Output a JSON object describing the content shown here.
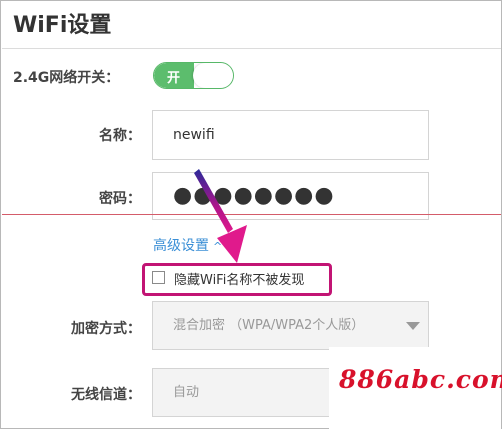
{
  "page": {
    "title": "WiFi设置"
  },
  "wifi_switch": {
    "label": "2.4G网络开关：",
    "state_text": "开",
    "on": true
  },
  "name_field": {
    "label": "名称：",
    "value": "newifi"
  },
  "password_field": {
    "label": "密码：",
    "value": "●●●●●●●●"
  },
  "advanced": {
    "label": "高级设置",
    "chevron": "^"
  },
  "hide_ssid": {
    "label": "隐藏WiFi名称不被发现",
    "checked": false
  },
  "encryption": {
    "label": "加密方式：",
    "selected": "混合加密 （WPA/WPA2个人版）"
  },
  "channel": {
    "label": "无线信道：",
    "selected": "自动"
  },
  "watermark": {
    "text": "886abc.com"
  },
  "colors": {
    "toggle_green": "#5cbd6d",
    "link_blue": "#3b8fd6",
    "annotation_magenta": "#c21474",
    "watermark_red": "#d8112b"
  }
}
